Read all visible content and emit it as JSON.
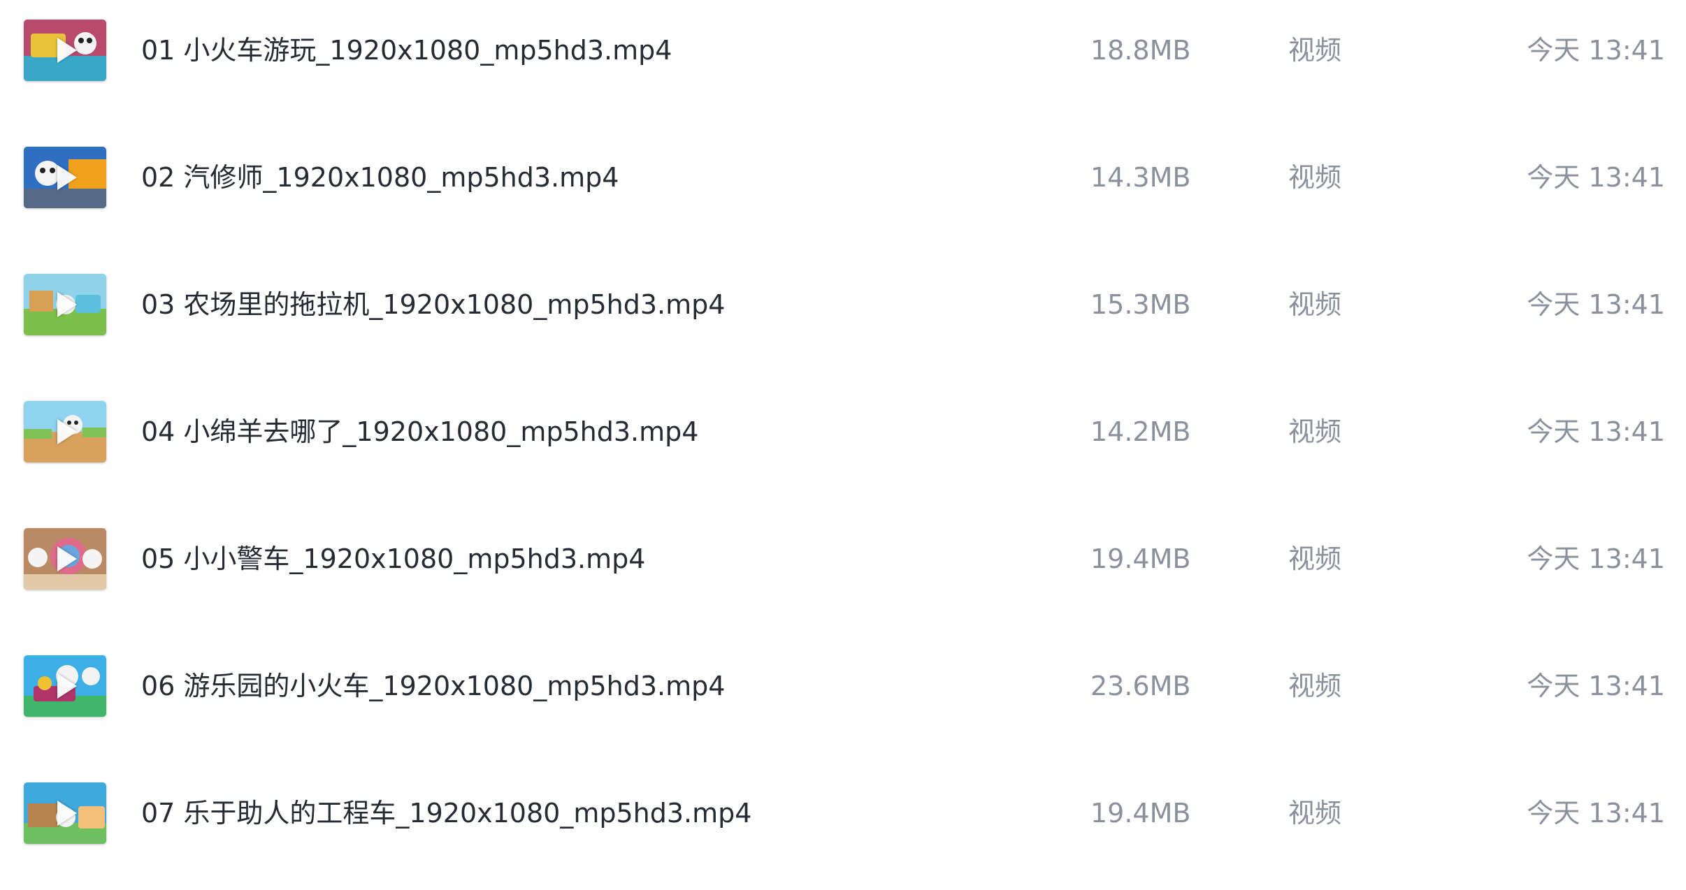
{
  "files": [
    {
      "index": "01",
      "name": "01 小火车游玩_1920x1080_mp5hd3.mp4",
      "size": "18.8MB",
      "type": "视频",
      "modified": "今天 13:41",
      "thumb_icon": "video-thumbnail-icon"
    },
    {
      "index": "02",
      "name": "02 汽修师_1920x1080_mp5hd3.mp4",
      "size": "14.3MB",
      "type": "视频",
      "modified": "今天 13:41",
      "thumb_icon": "video-thumbnail-icon"
    },
    {
      "index": "03",
      "name": "03 农场里的拖拉机_1920x1080_mp5hd3.mp4",
      "size": "15.3MB",
      "type": "视频",
      "modified": "今天 13:41",
      "thumb_icon": "video-thumbnail-icon"
    },
    {
      "index": "04",
      "name": "04 小绵羊去哪了_1920x1080_mp5hd3.mp4",
      "size": "14.2MB",
      "type": "视频",
      "modified": "今天 13:41",
      "thumb_icon": "video-thumbnail-icon"
    },
    {
      "index": "05",
      "name": "05 小小警车_1920x1080_mp5hd3.mp4",
      "size": "19.4MB",
      "type": "视频",
      "modified": "今天 13:41",
      "thumb_icon": "video-thumbnail-icon"
    },
    {
      "index": "06",
      "name": "06 游乐园的小火车_1920x1080_mp5hd3.mp4",
      "size": "23.6MB",
      "type": "视频",
      "modified": "今天 13:41",
      "thumb_icon": "video-thumbnail-icon"
    },
    {
      "index": "07",
      "name": "07 乐于助人的工程车_1920x1080_mp5hd3.mp4",
      "size": "19.4MB",
      "type": "视频",
      "modified": "今天 13:41",
      "thumb_icon": "video-thumbnail-icon"
    }
  ],
  "colors": {
    "filename_text": "#262a33",
    "meta_text": "#8a909c",
    "background": "#ffffff"
  }
}
